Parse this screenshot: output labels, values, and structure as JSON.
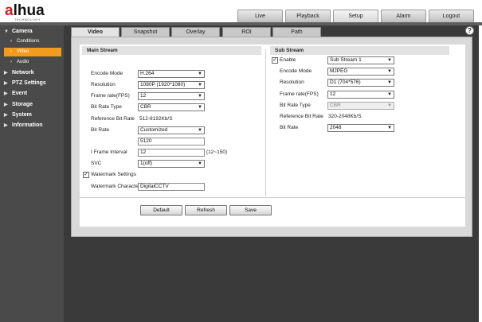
{
  "logo": {
    "brand_prefix": "a",
    "brand_rest": "lhua",
    "tagline": "TECHNOLOGY"
  },
  "top_tabs": [
    {
      "label": "Live"
    },
    {
      "label": "Playback"
    },
    {
      "label": "Setup",
      "active": true
    },
    {
      "label": "Alarm"
    },
    {
      "label": "Logout"
    }
  ],
  "sidebar": {
    "camera": {
      "label": "Camera",
      "icon": "triangle-down-icon"
    },
    "camera_items": [
      {
        "label": "Conditions"
      },
      {
        "label": "Video",
        "active": true
      },
      {
        "label": "Audio"
      }
    ],
    "sections": [
      {
        "label": "Network"
      },
      {
        "label": "PTZ Settings"
      },
      {
        "label": "Event"
      },
      {
        "label": "Storage"
      },
      {
        "label": "System"
      },
      {
        "label": "Information"
      }
    ]
  },
  "help_label": "?",
  "sub_tabs": [
    {
      "label": "Video",
      "active": true
    },
    {
      "label": "Snapshot"
    },
    {
      "label": "Overlay"
    },
    {
      "label": "ROI"
    },
    {
      "label": "Path"
    }
  ],
  "main_stream": {
    "title": "Main Stream",
    "encode_mode": {
      "label": "Encode Mode",
      "value": "H.264"
    },
    "resolution": {
      "label": "Resolution",
      "value": "1080P (1920*1080)"
    },
    "frame_rate": {
      "label": "Frame rate(FPS)",
      "value": "12"
    },
    "bit_rate_type": {
      "label": "Bit Rate Type",
      "value": "CBR"
    },
    "reference_bit_rate": {
      "label": "Reference Bit Rate",
      "value": "512-8192Kb/S"
    },
    "bit_rate": {
      "label": "Bit Rate",
      "value": "Customized",
      "custom_value": "5120"
    },
    "i_frame_interval": {
      "label": "I Frame Interval",
      "value": "12",
      "range": "(12~150)"
    },
    "svc": {
      "label": "SVC",
      "value": "1(off)"
    },
    "watermark_settings": {
      "label": "Watermark Settings",
      "checked": true
    },
    "watermark_character": {
      "label": "Watermark Character",
      "value": "DigitalCCTV"
    }
  },
  "sub_stream": {
    "title": "Sub Stream",
    "enable": {
      "label": "Enable",
      "checked": true,
      "value": "Sub Stream 1"
    },
    "encode_mode": {
      "label": "Encode Mode",
      "value": "MJPEG"
    },
    "resolution": {
      "label": "Resolution",
      "value": "D1 (704*576)"
    },
    "frame_rate": {
      "label": "Frame rate(FPS)",
      "value": "12"
    },
    "bit_rate_type": {
      "label": "Bit Rate Type",
      "value": "CBR"
    },
    "reference_bit_rate": {
      "label": "Reference Bit Rate",
      "value": "320-2048Kb/S"
    },
    "bit_rate": {
      "label": "Bit Rate",
      "value": "2048"
    }
  },
  "buttons": {
    "default": "Default",
    "refresh": "Refresh",
    "save": "Save"
  },
  "colors": {
    "accent": "#f29b1d",
    "brand_red": "#d71920",
    "sidebar_bg": "#4a4a4a",
    "page_bg": "#3a3a3a"
  }
}
